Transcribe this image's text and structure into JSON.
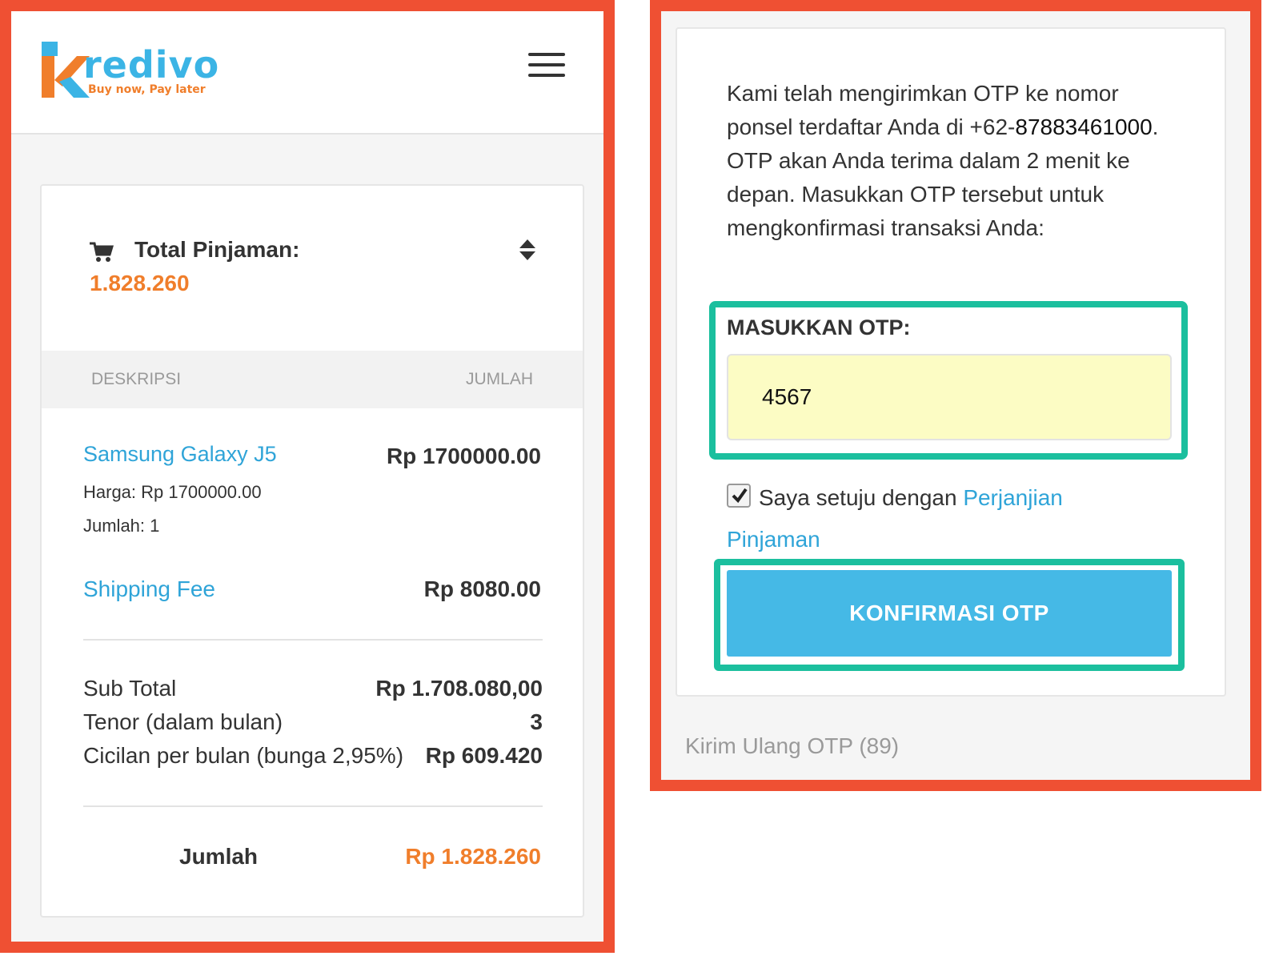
{
  "brand": {
    "name": "redivo",
    "tagline": "Buy now, Pay later",
    "colors": {
      "blue": "#3bb4e5",
      "orange": "#f07e2b",
      "frame": "#ef5033",
      "highlight": "#1bbf9e"
    }
  },
  "header": {
    "menu_icon": "hamburger-icon"
  },
  "summary": {
    "title": "Total Pinjaman:",
    "total": "1.828.260",
    "cart_icon": "cart-icon",
    "toggle_icon": "sort-icon"
  },
  "table": {
    "col_desc": "DESKRIPSI",
    "col_amount": "JUMLAH",
    "item": {
      "name": "Samsung Galaxy J5",
      "price": "Rp 1700000.00",
      "harga": "Harga: Rp 1700000.00",
      "jumlah": "Jumlah: 1"
    },
    "shipping": {
      "name": "Shipping Fee",
      "price": "Rp 8080.00"
    },
    "rows": [
      {
        "label": "Sub Total",
        "value": "Rp 1.708.080,00"
      },
      {
        "label": "Tenor (dalam bulan)",
        "value": "3"
      },
      {
        "label": "Cicilan per bulan (bunga 2,95%)",
        "value": "Rp 609.420"
      }
    ],
    "total_label": "Jumlah",
    "total_value": "Rp 1.828.260"
  },
  "otp": {
    "message_pre": "Kami telah mengirimkan OTP ke nomor ponsel terdaftar Anda di +62-",
    "phone": "87883461000",
    "message_post": ". OTP akan Anda terima dalam 2 menit ke depan. Masukkan OTP tersebut untuk mengkonfirmasi transaksi Anda:",
    "label": "MASUKKAN OTP:",
    "value": "4567",
    "agree_text": "Saya setuju dengan ",
    "agree_link_1": "Perjanjian",
    "agree_link_2": "Pinjaman",
    "agree_checked": true,
    "button": "KONFIRMASI OTP",
    "resend": "Kirim Ulang OTP (89)"
  }
}
